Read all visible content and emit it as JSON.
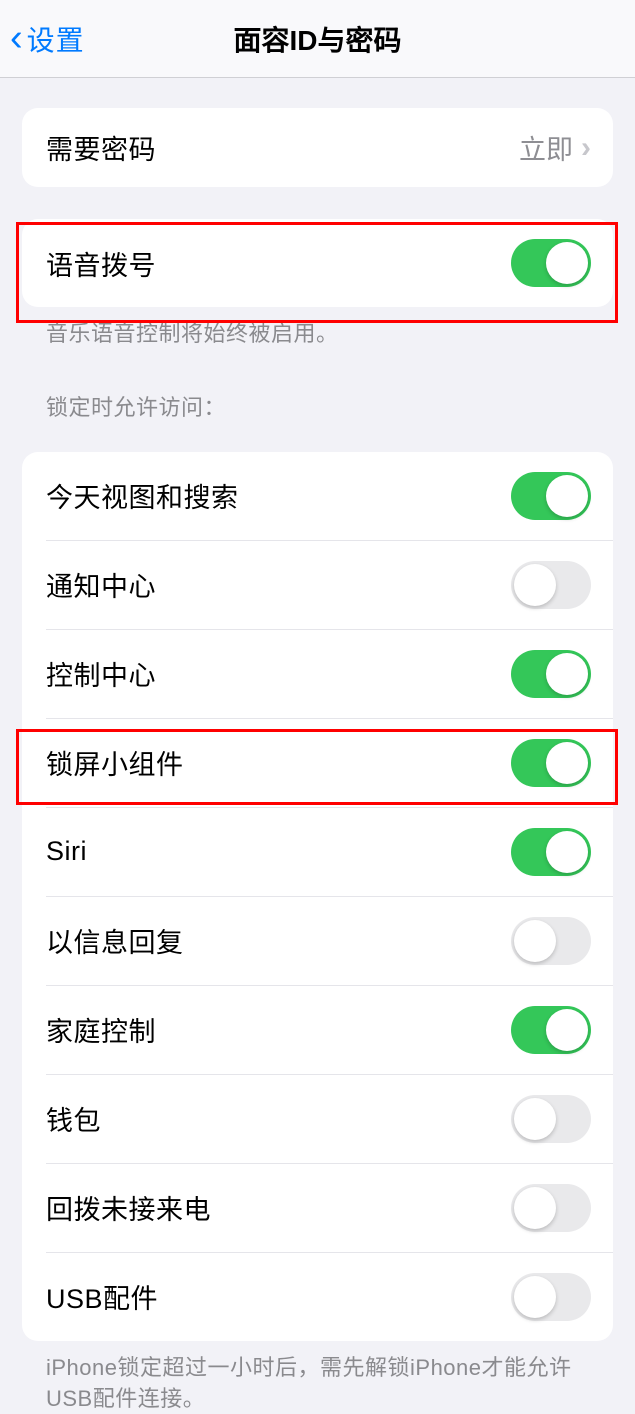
{
  "nav": {
    "back_label": "设置",
    "title": "面容ID与密码"
  },
  "require_passcode": {
    "label": "需要密码",
    "value": "立即"
  },
  "voice_dial": {
    "label": "语音拨号",
    "enabled": true,
    "footer": "音乐语音控制将始终被启用。"
  },
  "lock_access": {
    "header": "锁定时允许访问：",
    "items": [
      {
        "label": "今天视图和搜索",
        "enabled": true
      },
      {
        "label": "通知中心",
        "enabled": false
      },
      {
        "label": "控制中心",
        "enabled": true
      },
      {
        "label": "锁屏小组件",
        "enabled": true
      },
      {
        "label": "Siri",
        "enabled": true
      },
      {
        "label": "以信息回复",
        "enabled": false
      },
      {
        "label": "家庭控制",
        "enabled": true
      },
      {
        "label": "钱包",
        "enabled": false
      },
      {
        "label": "回拨未接来电",
        "enabled": false
      },
      {
        "label": "USB配件",
        "enabled": false
      }
    ],
    "footer": "iPhone锁定超过一小时后，需先解锁iPhone才能允许USB配件连接。"
  }
}
